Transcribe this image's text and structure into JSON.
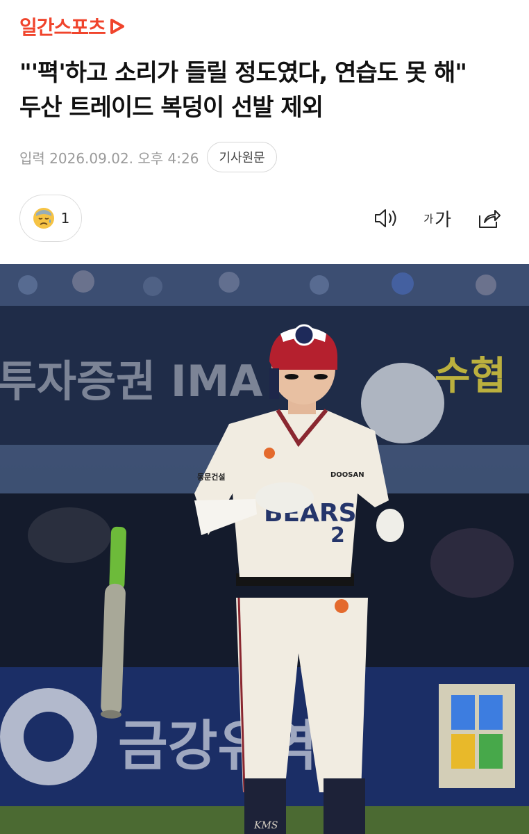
{
  "brand": {
    "name": "일간스포츠",
    "color": "#F0442C"
  },
  "article": {
    "title": "\"'펵'하고 소리가 들릴 정도였다, 연습도 못 해\" 두산 트레이드 복덩이 선발 제외",
    "date": "입력 2026.09.02. 오후 4:26",
    "origin_button": "기사원문"
  },
  "reaction": {
    "emoji": "sad-face",
    "count": "1"
  },
  "toolbar": {
    "icons": [
      "speaker-icon",
      "font-size-icon",
      "share-icon"
    ],
    "font_small": "가",
    "font_large": "가"
  },
  "photo": {
    "banner_left": "투자증권 IMA",
    "banner_right": "수협",
    "board_bottom": "금강유역",
    "jersey_team": "BEARS",
    "jersey_sponsor": "DOOSAN",
    "jersey_number": "2",
    "sleeve_patch": "동문건설",
    "sock_mark": "KMS"
  }
}
